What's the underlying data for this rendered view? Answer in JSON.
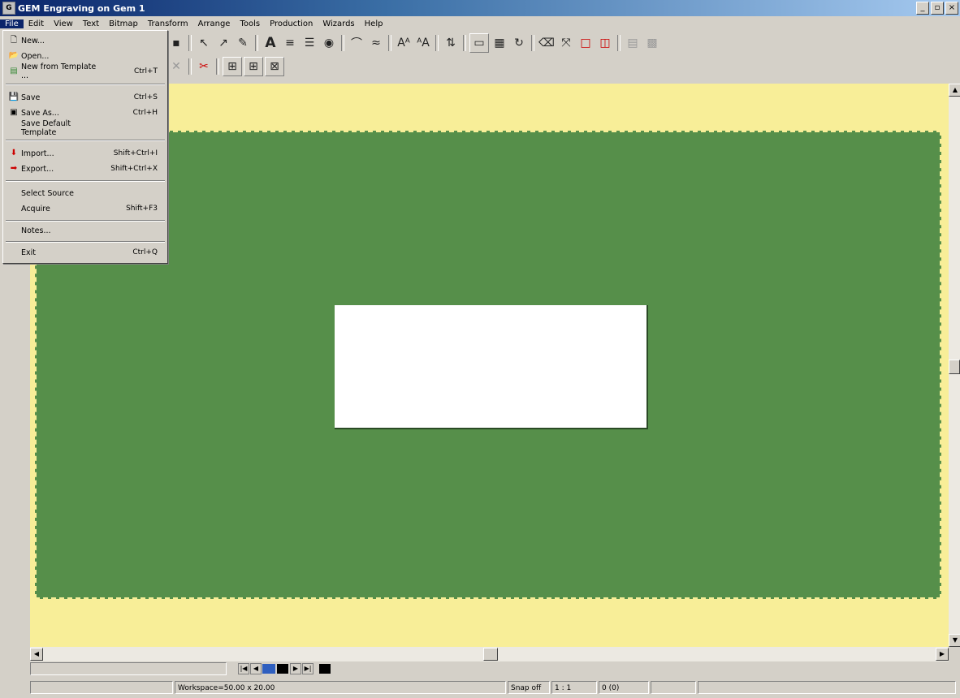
{
  "window": {
    "title": "GEM Engraving  on  Gem 1",
    "minimize": "_",
    "maximize": "▫",
    "close": "×"
  },
  "menubar": [
    "File",
    "Edit",
    "View",
    "Text",
    "Bitmap",
    "Transform",
    "Arrange",
    "Tools",
    "Production",
    "Wizards",
    "Help"
  ],
  "file_menu": {
    "new": {
      "label": "New...",
      "shortcut": ""
    },
    "open": {
      "label": "Open...",
      "shortcut": ""
    },
    "new_from_template": {
      "label": "New from Template ...",
      "shortcut": "Ctrl+T"
    },
    "save": {
      "label": "Save",
      "shortcut": "Ctrl+S"
    },
    "save_as": {
      "label": "Save As...",
      "shortcut": "Ctrl+H"
    },
    "save_default_template": {
      "label": "Save Default Template",
      "shortcut": ""
    },
    "import": {
      "label": "Import...",
      "shortcut": "Shift+Ctrl+I"
    },
    "export": {
      "label": "Export...",
      "shortcut": "Shift+Ctrl+X"
    },
    "select_source": {
      "label": "Select Source",
      "shortcut": ""
    },
    "acquire": {
      "label": "Acquire",
      "shortcut": "Shift+F3"
    },
    "notes": {
      "label": "Notes...",
      "shortcut": ""
    },
    "exit": {
      "label": "Exit",
      "shortcut": "Ctrl+Q"
    }
  },
  "colors": {
    "workspace_bg": "#f8ee98",
    "board": "#568f4a",
    "swatch_blue": "#2f5fbf",
    "swatch_black": "#000000"
  },
  "statusbar": {
    "workspace": "Workspace=50.00 x 20.00",
    "snap": "Snap off",
    "ratio": "1 : 1",
    "count": "0 (0)"
  }
}
